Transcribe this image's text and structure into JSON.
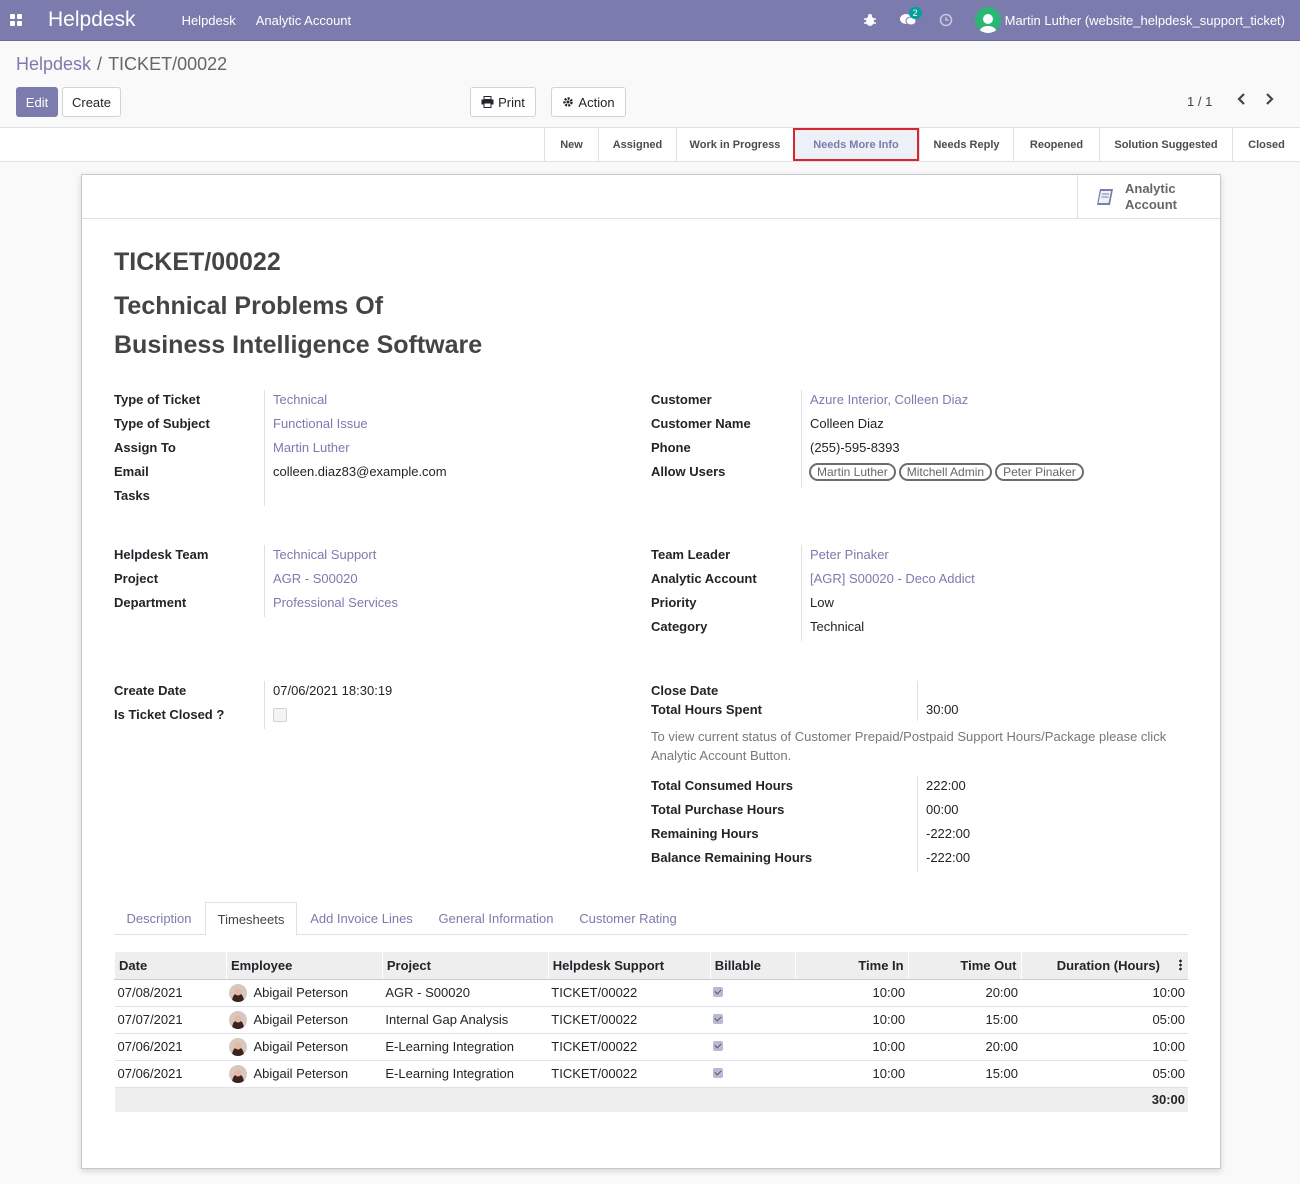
{
  "navbar": {
    "brand": "Helpdesk",
    "menu": [
      "Helpdesk",
      "Analytic Account"
    ],
    "chat_badge": "2",
    "user": "Martin Luther (website_helpdesk_support_ticket)"
  },
  "breadcrumb": {
    "parent": "Helpdesk",
    "sep": "/",
    "current": "TICKET/00022"
  },
  "buttons": {
    "edit": "Edit",
    "create": "Create",
    "print": "Print",
    "action": "Action"
  },
  "pager": {
    "value": "1 / 1"
  },
  "stages": [
    "New",
    "Assigned",
    "Work in Progress",
    "Needs More Info",
    "Needs Reply",
    "Reopened",
    "Solution Suggested",
    "Closed"
  ],
  "active_stage": "Needs More Info",
  "smart_button": {
    "line1": "Analytic",
    "line2": "Account"
  },
  "ticket": {
    "number": "TICKET/00022",
    "title_line1": "Technical Problems Of",
    "title_line2": "Business Intelligence Software"
  },
  "left_group1": [
    {
      "label": "Type of Ticket",
      "value": "Technical",
      "link": true
    },
    {
      "label": "Type of Subject",
      "value": "Functional Issue",
      "link": true
    },
    {
      "label": "Assign To",
      "value": "Martin Luther",
      "link": true
    },
    {
      "label": "Email",
      "value": "colleen.diaz83@example.com",
      "link": false
    },
    {
      "label": "Tasks",
      "value": "",
      "link": false
    }
  ],
  "right_group1": [
    {
      "label": "Customer",
      "value": "Azure Interior, Colleen Diaz",
      "link": true
    },
    {
      "label": "Customer Name",
      "value": "Colleen Diaz",
      "link": false
    },
    {
      "label": "Phone",
      "value": "(255)-595-8393",
      "link": false
    },
    {
      "label": "Allow Users",
      "value": "",
      "link": false
    }
  ],
  "allow_users": [
    "Martin Luther",
    "Mitchell Admin",
    "Peter Pinaker"
  ],
  "left_group2": [
    {
      "label": "Helpdesk Team",
      "value": "Technical Support",
      "link": true
    },
    {
      "label": "Project",
      "value": "AGR - S00020",
      "link": true
    },
    {
      "label": "Department",
      "value": "Professional Services",
      "link": true
    }
  ],
  "right_group2": [
    {
      "label": "Team Leader",
      "value": "Peter Pinaker",
      "link": true
    },
    {
      "label": "Analytic Account",
      "value": "[AGR] S00020 - Deco Addict",
      "link": true
    },
    {
      "label": "Priority",
      "value": "Low",
      "link": false
    },
    {
      "label": "Category",
      "value": "Technical",
      "link": false
    }
  ],
  "left_group3": [
    {
      "label": "Create Date",
      "value": "07/06/2021 18:30:19"
    },
    {
      "label": "Is Ticket Closed ?",
      "value": ""
    }
  ],
  "right_group3": {
    "close_date_label": "Close Date",
    "close_date_value": "",
    "total_hours_label": "Total Hours Spent",
    "total_hours_value": "30:00",
    "note": "To view current status of Customer Prepaid/Postpaid Support Hours/Package please click Analytic Account Button.",
    "hours": [
      {
        "label": "Total Consumed Hours",
        "value": "222:00"
      },
      {
        "label": "Total Purchase Hours",
        "value": "00:00"
      },
      {
        "label": "Remaining Hours",
        "value": "-222:00"
      },
      {
        "label": "Balance Remaining Hours",
        "value": "-222:00"
      }
    ]
  },
  "tabs": [
    "Description",
    "Timesheets",
    "Add Invoice Lines",
    "General Information",
    "Customer Rating"
  ],
  "active_tab": "Timesheets",
  "table": {
    "columns": [
      "Date",
      "Employee",
      "Project",
      "Helpdesk Support",
      "Billable",
      "Time In",
      "Time Out",
      "Duration (Hours)"
    ],
    "rows": [
      {
        "date": "07/08/2021",
        "employee": "Abigail Peterson",
        "project": "AGR - S00020",
        "support": "TICKET/00022",
        "time_in": "10:00",
        "time_out": "20:00",
        "duration": "10:00"
      },
      {
        "date": "07/07/2021",
        "employee": "Abigail Peterson",
        "project": "Internal Gap Analysis",
        "support": "TICKET/00022",
        "time_in": "10:00",
        "time_out": "15:00",
        "duration": "05:00"
      },
      {
        "date": "07/06/2021",
        "employee": "Abigail Peterson",
        "project": "E-Learning Integration",
        "support": "TICKET/00022",
        "time_in": "10:00",
        "time_out": "20:00",
        "duration": "10:00"
      },
      {
        "date": "07/06/2021",
        "employee": "Abigail Peterson",
        "project": "E-Learning Integration",
        "support": "TICKET/00022",
        "time_in": "10:00",
        "time_out": "15:00",
        "duration": "05:00"
      }
    ],
    "total": "30:00"
  },
  "colors": {
    "brand": "#7c7bad",
    "highlight": "#d9232d"
  }
}
